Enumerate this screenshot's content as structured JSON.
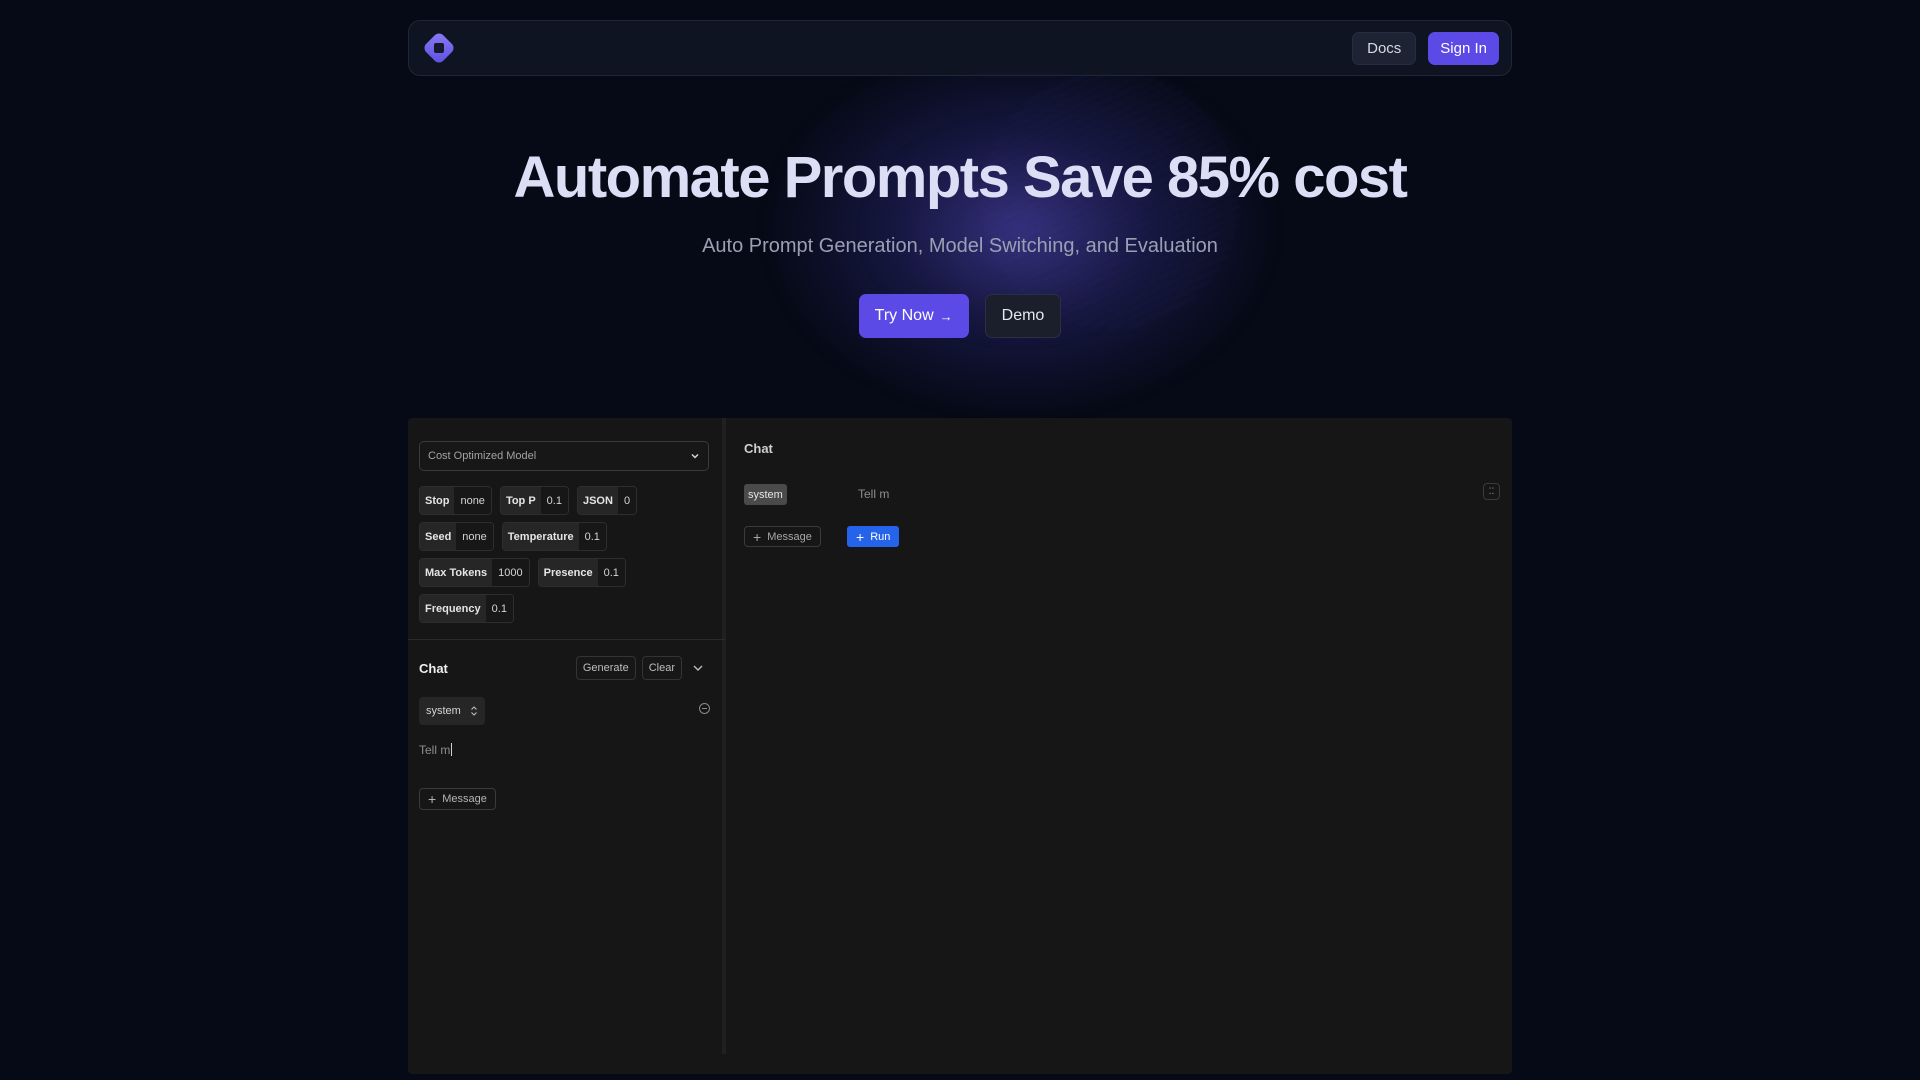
{
  "nav": {
    "logo_icon": "diamond-logo",
    "docs_label": "Docs",
    "signin_label": "Sign In"
  },
  "hero": {
    "title": "Automate Prompts Save 85% cost",
    "subtitle": "Auto Prompt Generation, Model Switching, and Evaluation",
    "try_label": "Try Now",
    "try_arrow": "→",
    "demo_label": "Demo"
  },
  "left_panel": {
    "model_select": "Cost Optimized Model",
    "params": [
      [
        {
          "k": "Stop",
          "v": "none"
        },
        {
          "k": "Top P",
          "v": "0.1"
        },
        {
          "k": "JSON",
          "v": "0"
        }
      ],
      [
        {
          "k": "Seed",
          "v": "none"
        },
        {
          "k": "Temperature",
          "v": "0.1"
        }
      ],
      [
        {
          "k": "Max Tokens",
          "v": "1000"
        },
        {
          "k": "Presence",
          "v": "0.1"
        }
      ],
      [
        {
          "k": "Frequency",
          "v": "0.1"
        }
      ]
    ],
    "chat_title": "Chat",
    "generate_label": "Generate",
    "clear_label": "Clear",
    "role": "system",
    "message_text": "Tell m",
    "add_message_label": "Message"
  },
  "right_panel": {
    "chat_title": "Chat",
    "role": "system",
    "message_text": "Tell m",
    "add_message_label": "Message",
    "run_label": "Run"
  },
  "colors": {
    "accent": "#5b4ae6",
    "run_blue": "#2563eb",
    "background": "#060a16"
  }
}
